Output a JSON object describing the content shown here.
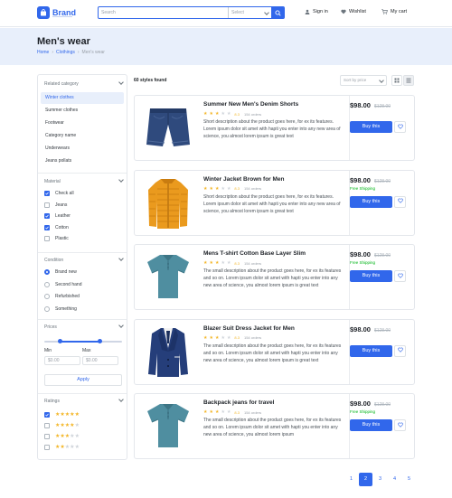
{
  "header": {
    "brand": "Brand",
    "search_placeholder": "Search",
    "select_value": "Select",
    "sign_in": "Sign in",
    "wishlist": "Wishlist",
    "cart": "My cart",
    "accent": "#3167eb"
  },
  "page": {
    "title": "Men's wear",
    "breadcrumb": [
      "Home",
      "Clothings",
      "Men's wear"
    ]
  },
  "sidebar": {
    "related_title": "Related category",
    "categories": [
      "Winter clothes",
      "Summer clothes",
      "Footwear",
      "Category name",
      "Underwears",
      "Jeans pollats"
    ],
    "material_title": "Material",
    "materials": [
      {
        "label": "Check all",
        "checked": true
      },
      {
        "label": "Jeans",
        "checked": false
      },
      {
        "label": "Leather",
        "checked": true
      },
      {
        "label": "Cotton",
        "checked": true
      },
      {
        "label": "Plastic",
        "checked": false
      }
    ],
    "condition_title": "Condition",
    "conditions": [
      {
        "label": "Brand new",
        "selected": true
      },
      {
        "label": "Second hand",
        "selected": false
      },
      {
        "label": "Refurbished",
        "selected": false
      },
      {
        "label": "Something",
        "selected": false
      }
    ],
    "prices_title": "Prices",
    "price_slider": {
      "low": 0.2,
      "high": 0.72
    },
    "min_label": "Min",
    "max_label": "Max",
    "min_placeholder": "$0.00",
    "max_placeholder": "$0.00",
    "apply_label": "Apply",
    "ratings_title": "Ratings",
    "ratings": [
      {
        "stars": 5,
        "checked": true
      },
      {
        "stars": 4,
        "checked": false
      },
      {
        "stars": 3,
        "checked": false
      },
      {
        "stars": 2,
        "checked": false
      }
    ]
  },
  "listing": {
    "count_text": "60 styles found",
    "sort_label": "Sort by price",
    "products": [
      {
        "name": "Summer New Men's Denim Shorts",
        "rating_value": "8.3",
        "orders": "154 orders",
        "stars": 3,
        "description": "Short description about the product goes here, for ex its features. Lorem ipsum dolor sit amet with hapti you enter into any new area of science, you almost lorem ipsum is great text",
        "price": "$98.00",
        "old_price": "$128.00",
        "shipping": "",
        "icon": "denim-shorts-icon"
      },
      {
        "name": "Winter Jacket Brown  for Men",
        "rating_value": "8.3",
        "orders": "154 orders",
        "stars": 3,
        "description": "Short description about the product goes here, for ex its features. Lorem ipsum dolor sit amet with hapti you enter into any new area of science, you almost lorem ipsum is great text",
        "price": "$98.00",
        "old_price": "$128.00",
        "shipping": "Free Shipping",
        "icon": "puffer-jacket-icon"
      },
      {
        "name": "Mens T-shirt Cotton Base Layer Slim",
        "rating_value": "8.3",
        "orders": "154 orders",
        "stars": 3,
        "description": "The small description about the product goes here, for ex its features and so on. Lorem ipsum dolor sit amet with hapti you enter into any new area of science, you almost lorem ipsum is great text",
        "price": "$98.00",
        "old_price": "$128.00",
        "shipping": "Free Shipping",
        "icon": "polo-shirt-icon"
      },
      {
        "name": "Blazer Suit Dress Jacket for Men",
        "rating_value": "8.3",
        "orders": "154 orders",
        "stars": 3,
        "description": "The small description about the product goes here, for ex its features and so on. Lorem ipsum dolor sit amet with hapti you enter into any new area of science, you almost lorem ipsum is great text",
        "price": "$98.00",
        "old_price": "$128.00",
        "shipping": "",
        "icon": "blazer-icon"
      },
      {
        "name": "Backpack jeans for travel",
        "rating_value": "8.3",
        "orders": "154 orders",
        "stars": 3,
        "description": "The small description about the product goes here, for ex its features and so on. Lorem ipsum dolor sit amet with hapti you enter into any new area of science, you almost lorem ipsum",
        "price": "$98.00",
        "old_price": "$128.00",
        "shipping": "Free Shipping",
        "icon": "polo-shirt-icon"
      }
    ],
    "buy_label": "Buy this"
  },
  "pagination": {
    "pages": [
      "1",
      "2",
      "3",
      "4",
      "5"
    ],
    "active": "2"
  }
}
